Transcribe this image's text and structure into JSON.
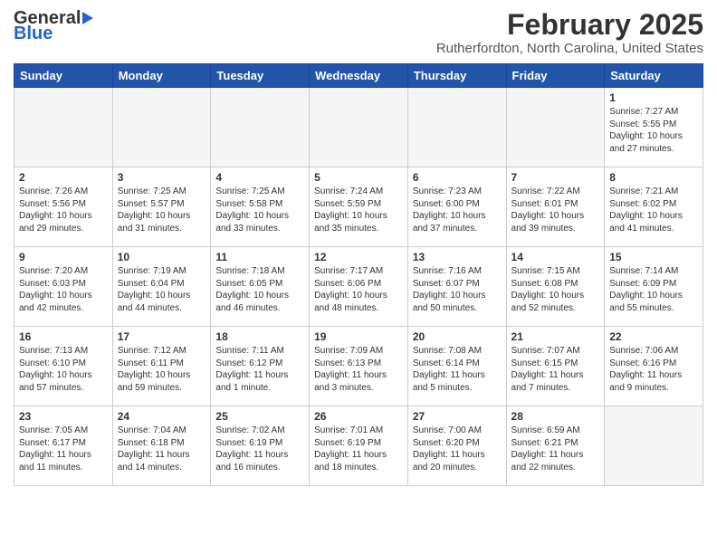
{
  "header": {
    "logo_line1": "General",
    "logo_line2": "Blue",
    "title": "February 2025",
    "subtitle": "Rutherfordton, North Carolina, United States"
  },
  "weekdays": [
    "Sunday",
    "Monday",
    "Tuesday",
    "Wednesday",
    "Thursday",
    "Friday",
    "Saturday"
  ],
  "weeks": [
    [
      {
        "day": "",
        "info": ""
      },
      {
        "day": "",
        "info": ""
      },
      {
        "day": "",
        "info": ""
      },
      {
        "day": "",
        "info": ""
      },
      {
        "day": "",
        "info": ""
      },
      {
        "day": "",
        "info": ""
      },
      {
        "day": "1",
        "info": "Sunrise: 7:27 AM\nSunset: 5:55 PM\nDaylight: 10 hours and 27 minutes."
      }
    ],
    [
      {
        "day": "2",
        "info": "Sunrise: 7:26 AM\nSunset: 5:56 PM\nDaylight: 10 hours and 29 minutes."
      },
      {
        "day": "3",
        "info": "Sunrise: 7:25 AM\nSunset: 5:57 PM\nDaylight: 10 hours and 31 minutes."
      },
      {
        "day": "4",
        "info": "Sunrise: 7:25 AM\nSunset: 5:58 PM\nDaylight: 10 hours and 33 minutes."
      },
      {
        "day": "5",
        "info": "Sunrise: 7:24 AM\nSunset: 5:59 PM\nDaylight: 10 hours and 35 minutes."
      },
      {
        "day": "6",
        "info": "Sunrise: 7:23 AM\nSunset: 6:00 PM\nDaylight: 10 hours and 37 minutes."
      },
      {
        "day": "7",
        "info": "Sunrise: 7:22 AM\nSunset: 6:01 PM\nDaylight: 10 hours and 39 minutes."
      },
      {
        "day": "8",
        "info": "Sunrise: 7:21 AM\nSunset: 6:02 PM\nDaylight: 10 hours and 41 minutes."
      }
    ],
    [
      {
        "day": "9",
        "info": "Sunrise: 7:20 AM\nSunset: 6:03 PM\nDaylight: 10 hours and 42 minutes."
      },
      {
        "day": "10",
        "info": "Sunrise: 7:19 AM\nSunset: 6:04 PM\nDaylight: 10 hours and 44 minutes."
      },
      {
        "day": "11",
        "info": "Sunrise: 7:18 AM\nSunset: 6:05 PM\nDaylight: 10 hours and 46 minutes."
      },
      {
        "day": "12",
        "info": "Sunrise: 7:17 AM\nSunset: 6:06 PM\nDaylight: 10 hours and 48 minutes."
      },
      {
        "day": "13",
        "info": "Sunrise: 7:16 AM\nSunset: 6:07 PM\nDaylight: 10 hours and 50 minutes."
      },
      {
        "day": "14",
        "info": "Sunrise: 7:15 AM\nSunset: 6:08 PM\nDaylight: 10 hours and 52 minutes."
      },
      {
        "day": "15",
        "info": "Sunrise: 7:14 AM\nSunset: 6:09 PM\nDaylight: 10 hours and 55 minutes."
      }
    ],
    [
      {
        "day": "16",
        "info": "Sunrise: 7:13 AM\nSunset: 6:10 PM\nDaylight: 10 hours and 57 minutes."
      },
      {
        "day": "17",
        "info": "Sunrise: 7:12 AM\nSunset: 6:11 PM\nDaylight: 10 hours and 59 minutes."
      },
      {
        "day": "18",
        "info": "Sunrise: 7:11 AM\nSunset: 6:12 PM\nDaylight: 11 hours and 1 minute."
      },
      {
        "day": "19",
        "info": "Sunrise: 7:09 AM\nSunset: 6:13 PM\nDaylight: 11 hours and 3 minutes."
      },
      {
        "day": "20",
        "info": "Sunrise: 7:08 AM\nSunset: 6:14 PM\nDaylight: 11 hours and 5 minutes."
      },
      {
        "day": "21",
        "info": "Sunrise: 7:07 AM\nSunset: 6:15 PM\nDaylight: 11 hours and 7 minutes."
      },
      {
        "day": "22",
        "info": "Sunrise: 7:06 AM\nSunset: 6:16 PM\nDaylight: 11 hours and 9 minutes."
      }
    ],
    [
      {
        "day": "23",
        "info": "Sunrise: 7:05 AM\nSunset: 6:17 PM\nDaylight: 11 hours and 11 minutes."
      },
      {
        "day": "24",
        "info": "Sunrise: 7:04 AM\nSunset: 6:18 PM\nDaylight: 11 hours and 14 minutes."
      },
      {
        "day": "25",
        "info": "Sunrise: 7:02 AM\nSunset: 6:19 PM\nDaylight: 11 hours and 16 minutes."
      },
      {
        "day": "26",
        "info": "Sunrise: 7:01 AM\nSunset: 6:19 PM\nDaylight: 11 hours and 18 minutes."
      },
      {
        "day": "27",
        "info": "Sunrise: 7:00 AM\nSunset: 6:20 PM\nDaylight: 11 hours and 20 minutes."
      },
      {
        "day": "28",
        "info": "Sunrise: 6:59 AM\nSunset: 6:21 PM\nDaylight: 11 hours and 22 minutes."
      },
      {
        "day": "",
        "info": ""
      }
    ]
  ]
}
